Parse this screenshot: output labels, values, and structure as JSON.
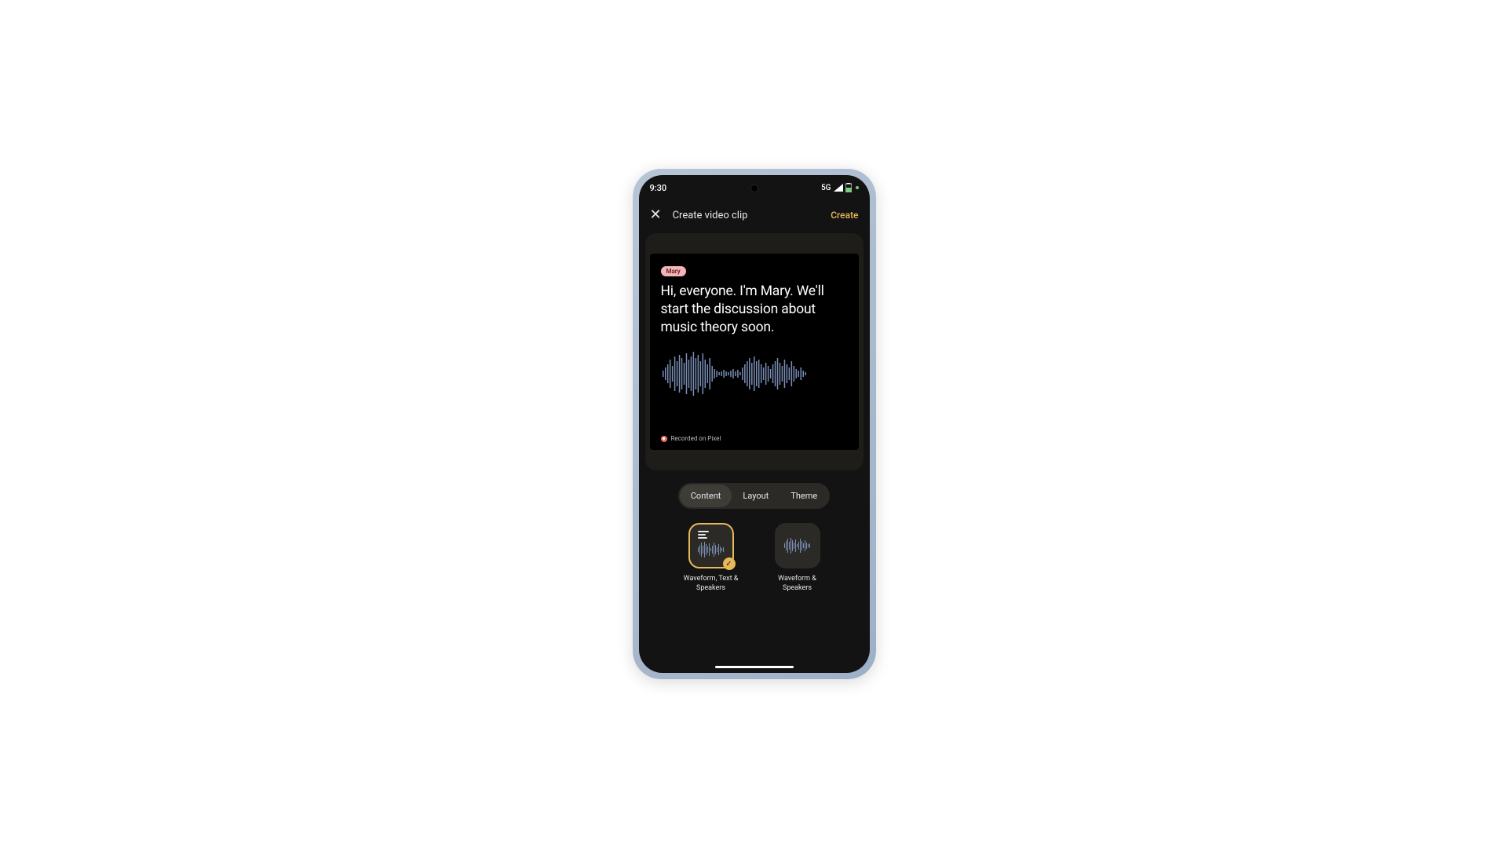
{
  "status": {
    "time": "9:30",
    "network": "5G"
  },
  "nav": {
    "title": "Create video clip",
    "action": "Create"
  },
  "preview": {
    "speaker": "Mary",
    "transcript": "Hi, everyone. I'm Mary. We'll start the discussion about music theory soon.",
    "recorded_label": "Recorded on Pixel"
  },
  "tabs": {
    "content": "Content",
    "layout": "Layout",
    "theme": "Theme",
    "active": "content"
  },
  "options": {
    "opt1": "Waveform, Text & Speakers",
    "opt2": "Waveform & Speakers"
  },
  "colors": {
    "accent": "#e8b959",
    "speaker_chip": "#f5b5b8",
    "waveform": "#7a8fb8"
  }
}
